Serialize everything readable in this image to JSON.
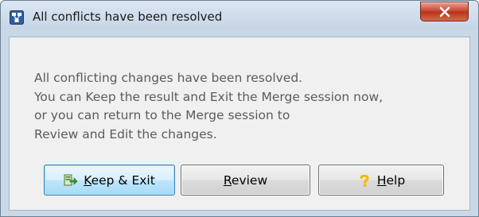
{
  "window": {
    "title": "All conflicts have been resolved",
    "close_icon": "close-x-icon",
    "app_icon": "merge-app-icon"
  },
  "message": {
    "lines": [
      "All conflicting changes have been resolved.",
      "You can Keep the result and Exit the Merge session now,",
      "or you can return to the Merge session to",
      "Review and Edit the changes."
    ]
  },
  "buttons": {
    "keep_exit": {
      "mnemonic": "K",
      "rest": "eep & Exit",
      "icon": "keep-exit-icon"
    },
    "review": {
      "mnemonic": "R",
      "rest": "eview"
    },
    "help": {
      "mnemonic": "H",
      "rest": "elp",
      "icon": "help-question-icon"
    }
  },
  "colors": {
    "title_bar": "#c6d5e6",
    "close_button": "#c9452e",
    "primary_button": "#bee6fd",
    "help_icon": "#f2b800"
  }
}
